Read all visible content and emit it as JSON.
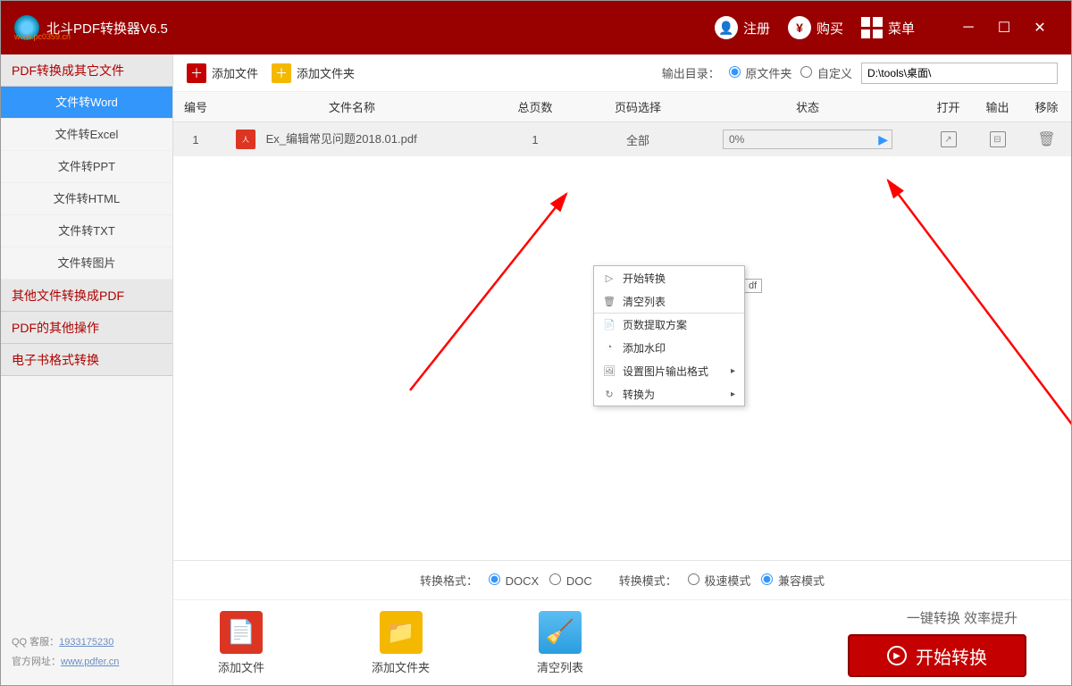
{
  "title": "北斗PDF转换器V6.5",
  "watermark": "www.pc0359.cn",
  "header": {
    "register": "注册",
    "buy": "购买",
    "menu": "菜单"
  },
  "sidebar": {
    "groups": [
      {
        "label": "PDF转换成其它文件",
        "items": [
          "文件转Word",
          "文件转Excel",
          "文件转PPT",
          "文件转HTML",
          "文件转TXT",
          "文件转图片"
        ],
        "active_index": 0
      },
      {
        "label": "其他文件转换成PDF",
        "items": []
      },
      {
        "label": "PDF的其他操作",
        "items": []
      },
      {
        "label": "电子书格式转换",
        "items": []
      }
    ],
    "footer": {
      "qq_label": "QQ 客服：",
      "qq_value": "1933175230",
      "site_label": "官方网址：",
      "site_value": "www.pdfer.cn"
    }
  },
  "toolbar": {
    "add_file": "添加文件",
    "add_folder": "添加文件夹",
    "output_label": "输出目录：",
    "opt_original": "原文件夹",
    "opt_custom": "自定义",
    "path": "D:\\tools\\桌面\\"
  },
  "table": {
    "headers": {
      "num": "编号",
      "name": "文件名称",
      "pages": "总页数",
      "sel": "页码选择",
      "status": "状态",
      "open": "打开",
      "out": "输出",
      "del": "移除"
    },
    "rows": [
      {
        "num": "1",
        "name": "Ex_编辑常见问题2018.01.pdf",
        "pages": "1",
        "sel": "全部",
        "status": "0%"
      }
    ]
  },
  "context_menu": {
    "items": [
      {
        "icon": "▷",
        "label": "开始转换"
      },
      {
        "icon": "🗑",
        "label": "清空列表"
      },
      {
        "icon": "📄",
        "label": "页数提取方案",
        "sep": true
      },
      {
        "icon": "◔",
        "label": "添加水印"
      },
      {
        "icon": "🖼",
        "label": "设置图片输出格式",
        "sub": true
      },
      {
        "icon": "↻",
        "label": "转换为",
        "sub": true
      }
    ],
    "suffix_badge": "df"
  },
  "options": {
    "format_label": "转换格式：",
    "format_opts": [
      "DOCX",
      "DOC"
    ],
    "mode_label": "转换模式：",
    "mode_opts": [
      "极速模式",
      "兼容模式"
    ]
  },
  "big_actions": {
    "add_file": "添加文件",
    "add_folder": "添加文件夹",
    "clear": "清空列表"
  },
  "slogan": "一键转换  效率提升",
  "start": "开始转换"
}
